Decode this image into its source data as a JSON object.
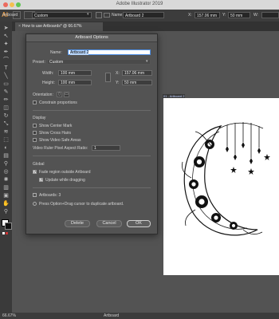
{
  "window": {
    "app_title": "Adobe Illustrator 2019"
  },
  "control_bar": {
    "selection_label": "Artboard",
    "preset_value": "Custom",
    "name_label": "Name:",
    "name_value": "Artboard 2",
    "x_label": "X:",
    "x_value": "157.06 mm",
    "y_label": "Y:",
    "y_value": "50 mm"
  },
  "document_tab": {
    "label": "How to use Artboards* @ 66.67% (CMYK/GPU Preview)",
    "close": "×"
  },
  "artboard": {
    "label": "01 - Artboard 2"
  },
  "status_bar": {
    "zoom": "66.67%",
    "tool": "Artboard"
  },
  "dialog": {
    "title": "Artboard Options",
    "name_label": "Name:",
    "name_value": "Artboard 2",
    "preset_label": "Preset:",
    "preset_value": "Custom",
    "width_label": "Width:",
    "width_value": "100 mm",
    "height_label": "Height:",
    "height_value": "100 mm",
    "x_label": "X:",
    "x_value": "157.06 mm",
    "y_label": "Y:",
    "y_value": "50 mm",
    "orientation_label": "Orientation:",
    "constrain_label": "Constrain proportions",
    "display_heading": "Display",
    "center_mark_label": "Show Center Mark",
    "cross_hairs_label": "Show Cross Hairs",
    "safe_areas_label": "Show Video Safe Areas",
    "aspect_label": "Video Ruler Pixel Aspect Ratio:",
    "aspect_value": "1",
    "global_heading": "Global",
    "fade_label": "Fade region outside Artboard",
    "update_label": "Update while dragging",
    "artboards_count": "Artboards: 3",
    "hint": "Press Option+Drag cursor to duplicate artboard.",
    "delete_label": "Delete",
    "cancel_label": "Cancel",
    "ok_label": "OK",
    "checks": {
      "constrain": false,
      "center": false,
      "crosshairs": false,
      "safe": false,
      "fade": true,
      "update": true
    }
  }
}
